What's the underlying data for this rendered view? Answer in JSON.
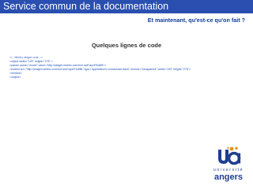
{
  "header": {
    "title": "Service commun de la documentation"
  },
  "subtitle": "Et maintenant, qu'est-ce qu'on fait ?",
  "section_title": "Quelques lignes de code",
  "code_lines": [
    "<!-- Meebo widget code -->",
    "<object width=\"190\" height=\"275\" >",
    "<param name=\"movie\" value=\"http://widget.meebo.com/mm.swf?ayxFHo8flk\">",
    "<embed src=\"http://widget.meebo.com/mm.swf?ayxFHo8flk\" type=\"application/x-shockwave-flash\" wmode=\"transparent\" width=\"190\" height=\"275\">",
    "</embed>",
    "</object>"
  ],
  "logo": {
    "univ": "université",
    "city": "angers"
  },
  "colors": {
    "header_bg": "#2a4fb0",
    "header_text": "#ffffff",
    "accent_blue": "#123d9a",
    "logo_blue": "#1e3e8f",
    "logo_orange": "#e8911d"
  }
}
